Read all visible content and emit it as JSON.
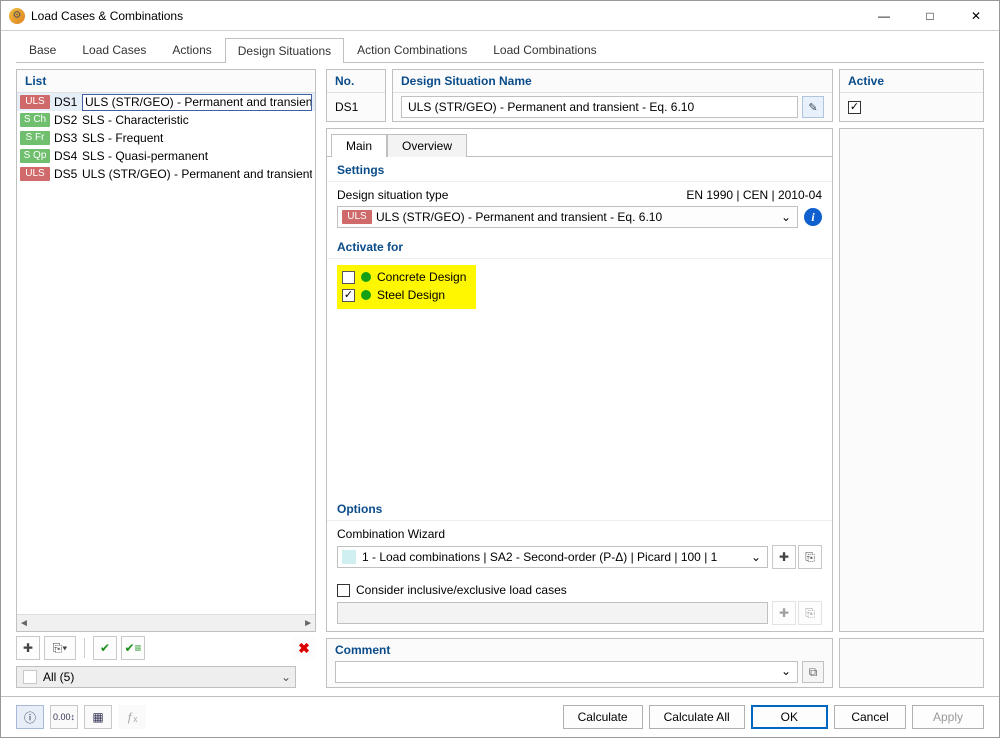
{
  "title": "Load Cases & Combinations",
  "window_controls": {
    "min": "—",
    "max": "□",
    "close": "✕"
  },
  "tabs": [
    "Base",
    "Load Cases",
    "Actions",
    "Design Situations",
    "Action Combinations",
    "Load Combinations"
  ],
  "active_tab": "Design Situations",
  "list": {
    "header": "List",
    "items": [
      {
        "tag": "ULS",
        "tag_bg": "#d06a6a",
        "ds": "DS1",
        "label": "ULS (STR/GEO) - Permanent and transient - E",
        "selected": true
      },
      {
        "tag": "S Ch",
        "tag_bg": "#6fbf6f",
        "ds": "DS2",
        "label": "SLS - Characteristic"
      },
      {
        "tag": "S Fr",
        "tag_bg": "#6fbf6f",
        "ds": "DS3",
        "label": "SLS - Frequent"
      },
      {
        "tag": "S Qp",
        "tag_bg": "#6fbf6f",
        "ds": "DS4",
        "label": "SLS - Quasi-permanent"
      },
      {
        "tag": "ULS",
        "tag_bg": "#d06a6a",
        "ds": "DS5",
        "label": "ULS (STR/GEO) - Permanent and transient - E"
      }
    ],
    "filter": "All (5)"
  },
  "toolbar_icons": {
    "new": "✚",
    "copy_dd": "⎘▾",
    "check_all": "✔",
    "check_some": "✔≡",
    "delete": "✖"
  },
  "header": {
    "no_label": "No.",
    "no_value": "DS1",
    "name_label": "Design Situation Name",
    "name_value": "ULS (STR/GEO) - Permanent and transient - Eq. 6.10",
    "name_icon": "✎",
    "active_label": "Active",
    "active_checked": true
  },
  "subtabs": [
    "Main",
    "Overview"
  ],
  "active_subtab": "Main",
  "settings": {
    "section": "Settings",
    "type_label": "Design situation type",
    "type_std": "EN 1990 | CEN | 2010-04",
    "type_tag": "ULS",
    "type_tag_bg": "#d06a6a",
    "type_value": "ULS (STR/GEO) - Permanent and transient - Eq. 6.10",
    "info": "i"
  },
  "activate": {
    "section": "Activate for",
    "concrete_label": "Concrete Design",
    "concrete_checked": false,
    "steel_label": "Steel Design",
    "steel_checked": true
  },
  "options": {
    "section": "Options",
    "wizard_label": "Combination Wizard",
    "wizard_value": "1 - Load combinations | SA2 - Second-order (P-Δ) | Picard | 100 | 1",
    "wizard_new": "✚",
    "wizard_edit": "⎘",
    "consider_label": "Consider inclusive/exclusive load cases",
    "consider_checked": false,
    "consider_new": "✚",
    "consider_edit": "⎘"
  },
  "comment": {
    "label": "Comment",
    "value": "",
    "attach": "⧉"
  },
  "footer": {
    "tip": "ⓘ",
    "units": "0.00↕",
    "details": "▦",
    "fx": "ƒₓ",
    "calculate": "Calculate",
    "calculate_all": "Calculate All",
    "ok": "OK",
    "cancel": "Cancel",
    "apply": "Apply"
  }
}
